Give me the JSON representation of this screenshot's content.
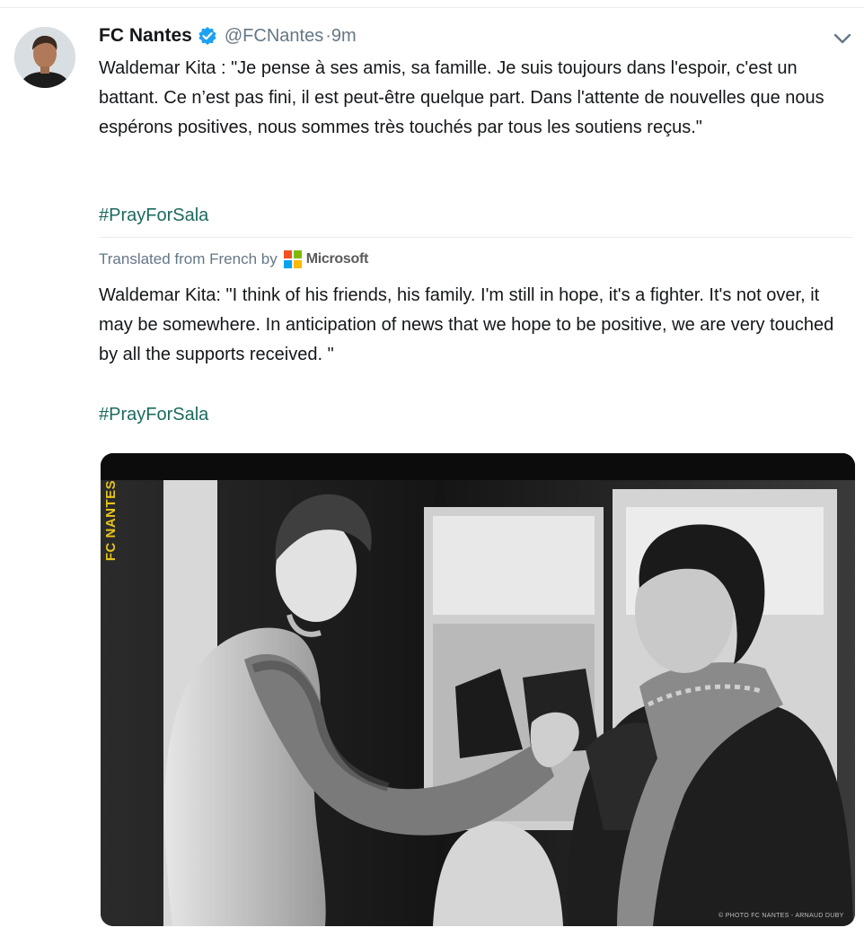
{
  "tweet": {
    "display_name": "FC Nantes",
    "handle": "@FCNantes",
    "separator": "·",
    "time": "9m",
    "text": "Waldemar Kita : \"Je pense à ses amis, sa famille. Je suis toujours dans l'espoir, c'est un battant. Ce n’est pas fini, il est peut-être quelque part. Dans l'attente de nouvelles que nous espérons positives, nous sommes très touchés par tous les soutiens reçus.\"",
    "hashtag": "#PrayForSala",
    "translation": {
      "label": "Translated from French by",
      "provider": "Microsoft",
      "text": "Waldemar Kita: \"I think of his friends, his family. I'm still in hope, it's a fighter. It's not over, it may be somewhere. In anticipation of news that we hope to be positive, we are very touched by all the supports received. \"",
      "hashtag": "#PrayForSala"
    },
    "media": {
      "watermark": "FC NANTES",
      "credit": "© PHOTO FC NANTES - ARNAUD DUBY"
    }
  },
  "icons": {
    "verified": "verified-badge-icon",
    "menu": "chevron-down-icon",
    "translator": "microsoft-logo-icon"
  },
  "colors": {
    "verified_blue": "#1da1f2",
    "hashtag": "#1b6a5e",
    "secondary_text": "#657786",
    "watermark_yellow": "#e7c41a",
    "ms_red": "#f25022",
    "ms_green": "#7fba00",
    "ms_blue": "#00a4ef",
    "ms_yellow": "#ffb900"
  }
}
